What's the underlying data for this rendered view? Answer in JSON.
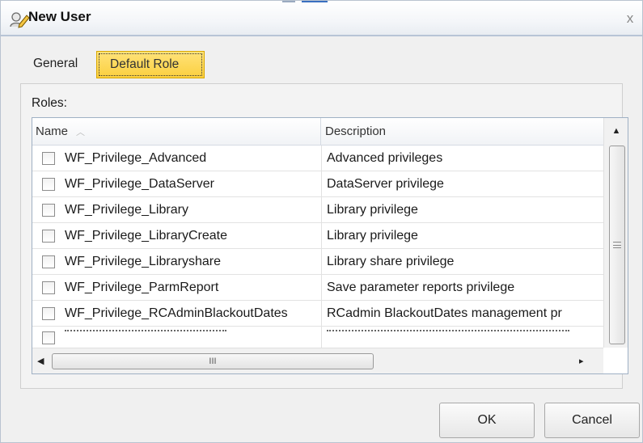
{
  "dialog": {
    "title": "New User",
    "close_glyph": "x",
    "title_icon": "user-edit-icon"
  },
  "tabs": [
    {
      "label": "General",
      "active": false
    },
    {
      "label": "Default Role",
      "active": true
    }
  ],
  "roles": {
    "label": "Roles:",
    "columns": {
      "name": "Name",
      "description": "Description"
    },
    "rows": [
      {
        "name": "WF_Privilege_Advanced",
        "description": "Advanced privileges",
        "checked": false
      },
      {
        "name": "WF_Privilege_DataServer",
        "description": "DataServer privilege",
        "checked": false
      },
      {
        "name": "WF_Privilege_Library",
        "description": "Library privilege",
        "checked": false
      },
      {
        "name": "WF_Privilege_LibraryCreate",
        "description": "Library privilege",
        "checked": false
      },
      {
        "name": "WF_Privilege_Libraryshare",
        "description": "Library share privilege",
        "checked": false
      },
      {
        "name": "WF_Privilege_ParmReport",
        "description": "Save parameter reports privilege",
        "checked": false
      },
      {
        "name": "WF_Privilege_RCAdminBlackoutDates",
        "description": "RCadmin BlackoutDates management pr",
        "checked": false
      }
    ],
    "scrollbar_grip": "III"
  },
  "buttons": {
    "ok": "OK",
    "cancel": "Cancel"
  },
  "colors": {
    "active_tab": "#fbcf3e",
    "title_accent": "#3a6fc0"
  }
}
